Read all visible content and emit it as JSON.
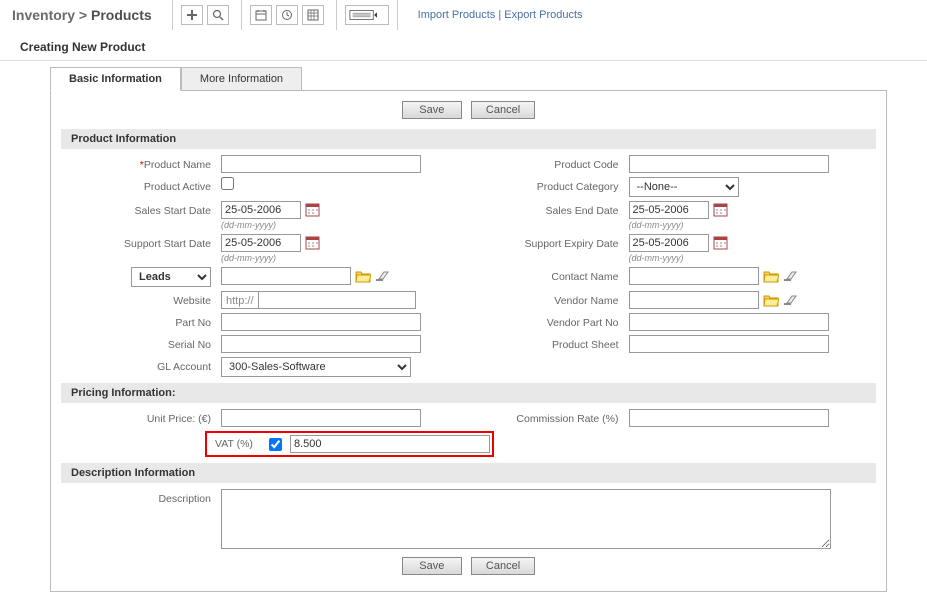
{
  "breadcrumb": {
    "parent": "Inventory",
    "sep": ">",
    "current": "Products"
  },
  "links": {
    "import": "Import Products",
    "export": "Export Products",
    "sep": " | "
  },
  "subheader": "Creating New Product",
  "tabs": {
    "basic": "Basic Information",
    "more": "More Information"
  },
  "buttons": {
    "save": "Save",
    "cancel": "Cancel"
  },
  "sections": {
    "product": "Product Information",
    "pricing": "Pricing Information:",
    "description": "Description Information"
  },
  "labels": {
    "productName": "Product Name",
    "productActive": "Product Active",
    "salesStart": "Sales Start Date",
    "supportStart": "Support Start Date",
    "website": "Website",
    "partNo": "Part No",
    "serialNo": "Serial No",
    "glAccount": "GL Account",
    "productCode": "Product Code",
    "productCategory": "Product Category",
    "salesEnd": "Sales End Date",
    "supportExpiry": "Support Expiry Date",
    "contactName": "Contact Name",
    "vendorName": "Vendor Name",
    "vendorPart": "Vendor Part No",
    "productSheet": "Product Sheet",
    "unitPrice": "Unit Price: (€)",
    "commission": "Commission Rate (%)",
    "vat": "VAT (%)",
    "description": "Description",
    "httpPrefix": "http://"
  },
  "hints": {
    "dateFormat": "(dd-mm-yyyy)"
  },
  "values": {
    "salesStart": "25-05-2006",
    "supportStart": "25-05-2006",
    "salesEnd": "25-05-2006",
    "supportExpiry": "25-05-2006",
    "leadsSelect": "Leads",
    "glAccount": "300-Sales-Software",
    "category": "--None--",
    "vat": "8.500"
  }
}
